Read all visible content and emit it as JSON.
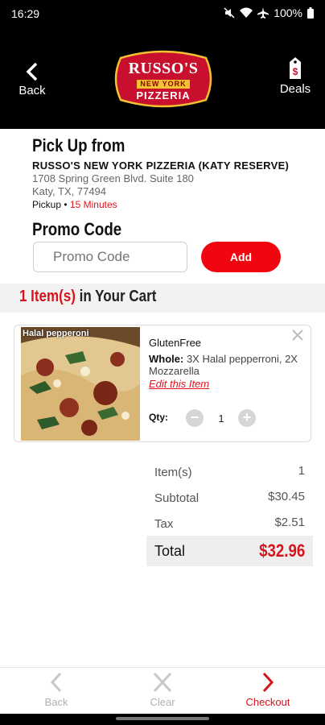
{
  "status_bar": {
    "time": "16:29",
    "battery": "100%"
  },
  "header": {
    "back_label": "Back",
    "deals_label": "Deals",
    "logo": {
      "line1": "RUSSO'S",
      "line2": "NEW YORK",
      "line3": "PIZZERIA"
    },
    "colors": {
      "background": "#000000",
      "logo_red": "#c8102e",
      "logo_gold": "#f2c230"
    }
  },
  "pickup": {
    "title": "Pick Up from",
    "store": "RUSSO'S NEW YORK PIZZERIA (KATY RESERVE)",
    "address_line1": "1708 Spring Green Blvd. Suite 180",
    "address_line2": "Katy, TX, 77494",
    "mode": "Pickup",
    "separator": "•",
    "time": "15 Minutes"
  },
  "promo": {
    "title": "Promo Code",
    "placeholder": "Promo Code",
    "add_label": "Add"
  },
  "cart": {
    "count": "1 Item(s)",
    "suffix": "in Your Cart",
    "items": [
      {
        "image_caption": "Halal pepperoni",
        "name": "GlutenFree",
        "size": "Whole:",
        "toppings": "3X Halal pepperroni, 2X Mozzarella",
        "edit_label": "Edit this Item",
        "qty_label": "Qty:",
        "qty": "1",
        "minus": "−",
        "plus": "+"
      }
    ]
  },
  "totals": {
    "items_label": "Item(s)",
    "items_value": "1",
    "subtotal_label": "Subtotal",
    "subtotal_value": "$30.45",
    "tax_label": "Tax",
    "tax_value": "$2.51",
    "total_label": "Total",
    "total_value": "$32.96"
  },
  "bottom_nav": {
    "back": "Back",
    "clear": "Clear",
    "checkout": "Checkout"
  },
  "accent_color": "#e0141e"
}
